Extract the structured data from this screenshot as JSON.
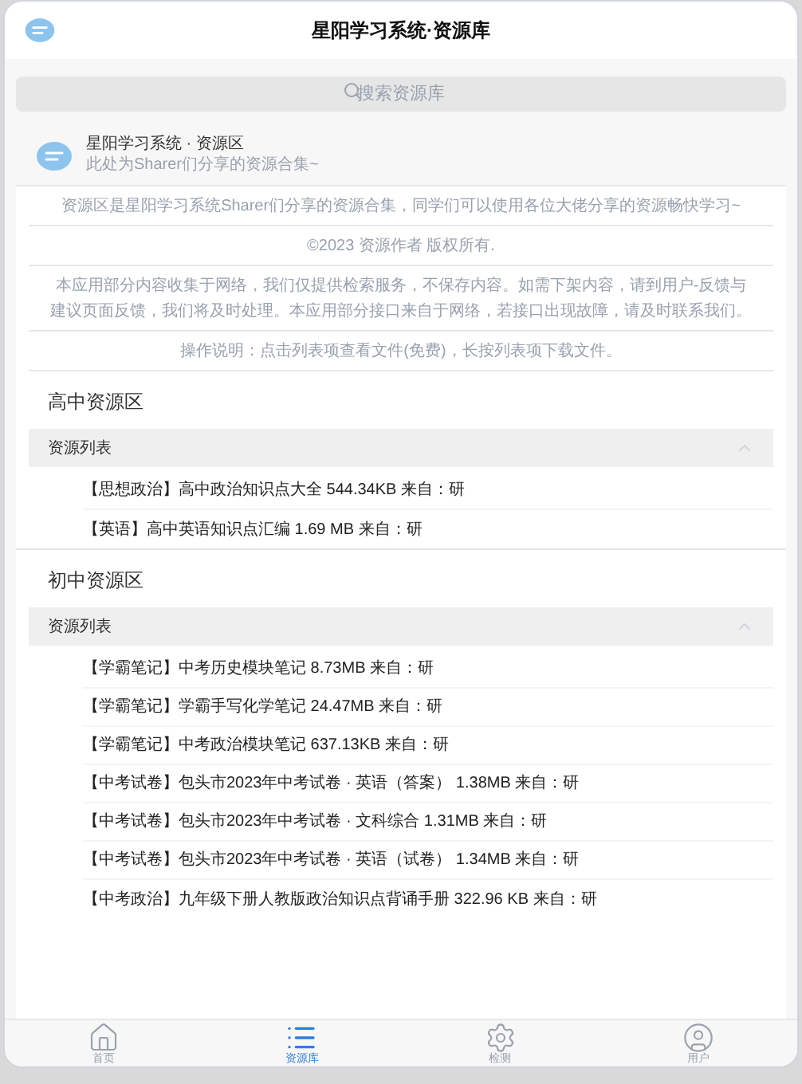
{
  "header": {
    "title": "星阳学习系统·资源库"
  },
  "search": {
    "placeholder": "搜索资源库"
  },
  "intro_card": {
    "title": "星阳学习系统 · 资源区",
    "subtitle": "此处为Sharer们分享的资源合集~"
  },
  "notices": [
    "资源区是星阳学习系统Sharer们分享的资源合集，同学们可以使用各位大佬分享的资源畅快学习~",
    "©2023 资源作者 版权所有.",
    "本应用部分内容收集于网络，我们仅提供检索服务，不保存内容。如需下架内容，请到用户-反馈与建议页面反馈，我们将及时处理。本应用部分接口来自于网络，若接口出现故障，请及时联系我们。",
    "操作说明：点击列表项查看文件(免费)，长按列表项下载文件。"
  ],
  "sections": [
    {
      "title": "高中资源区",
      "panel": {
        "label": "资源列表",
        "expanded": true
      },
      "items": [
        "【思想政治】高中政治知识点大全 544.34KB 来自：研",
        "【英语】高中英语知识点汇编 1.69 MB 来自：研"
      ]
    },
    {
      "title": "初中资源区",
      "panel": {
        "label": "资源列表",
        "expanded": true
      },
      "items": [
        "【学霸笔记】中考历史模块笔记 8.73MB 来自：研",
        "【学霸笔记】学霸手写化学笔记 24.47MB 来自：研",
        "【学霸笔记】中考政治模块笔记 637.13KB 来自：研",
        "【中考试卷】包头市2023年中考试卷 · 英语（答案） 1.38MB 来自：研",
        "【中考试卷】包头市2023年中考试卷 · 文科综合 1.31MB 来自：研",
        "【中考试卷】包头市2023年中考试卷 · 英语（试卷） 1.34MB 来自：研",
        "【中考政治】九年级下册人教版政治知识点背诵手册 322.96 KB 来自：研"
      ]
    }
  ],
  "tab_bar": [
    {
      "label": "首页",
      "kind": "home",
      "selected": false
    },
    {
      "label": "资源库",
      "kind": "list",
      "selected": true
    },
    {
      "label": "检测",
      "kind": "gear",
      "selected": false
    },
    {
      "label": "用户",
      "kind": "user",
      "selected": false
    }
  ]
}
